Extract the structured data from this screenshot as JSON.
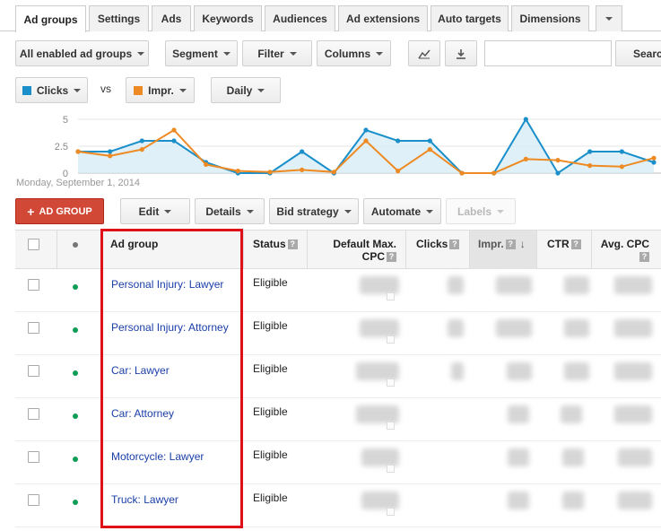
{
  "tabs": [
    "Ad groups",
    "Settings",
    "Ads",
    "Keywords",
    "Audiences",
    "Ad extensions",
    "Auto targets",
    "Dimensions"
  ],
  "toolbar": {
    "filter_select": "All enabled ad groups",
    "segment": "Segment",
    "filter": "Filter",
    "columns": "Columns",
    "search_button": "Search"
  },
  "chart_controls": {
    "metric1": "Clicks",
    "vs": "vs",
    "metric2": "Impr.",
    "granularity": "Daily"
  },
  "colors": {
    "clicks": "#1a8fc9",
    "impr": "#ee8a23",
    "add_button": "#d14836",
    "highlight": "#e0101a",
    "enabled_dot": "#0f9d58"
  },
  "chart_data": {
    "type": "line",
    "x_label_start": "Monday, September 1, 2014",
    "y_ticks": [
      "5",
      "2.5",
      "0"
    ],
    "ylim": [
      0,
      5
    ],
    "series": [
      {
        "name": "Clicks",
        "values": [
          2,
          2,
          3,
          3,
          1,
          0,
          0,
          2,
          0,
          4,
          3,
          3,
          0,
          0,
          5,
          0,
          2,
          2,
          1
        ]
      },
      {
        "name": "Impr.",
        "values": [
          2,
          1.6,
          2.2,
          4,
          0.8,
          0.2,
          0.1,
          0.3,
          0.1,
          3,
          0.2,
          2.2,
          0,
          0,
          1.3,
          1.2,
          0.7,
          0.6,
          1.4
        ]
      }
    ]
  },
  "actions": {
    "add_group": "AD GROUP",
    "edit": "Edit",
    "details": "Details",
    "bid_strategy": "Bid strategy",
    "automate": "Automate",
    "labels": "Labels"
  },
  "columns": {
    "ad_group": "Ad group",
    "status": "Status",
    "default_max_cpc_1": "Default Max.",
    "default_max_cpc_2": "CPC",
    "clicks": "Clicks",
    "impr": "Impr.",
    "ctr": "CTR",
    "avg_cpc": "Avg. CPC"
  },
  "rows": [
    {
      "name": "Personal Injury: Lawyer",
      "status": "Eligible"
    },
    {
      "name": "Personal Injury: Attorney",
      "status": "Eligible"
    },
    {
      "name": "Car: Lawyer",
      "status": "Eligible"
    },
    {
      "name": "Car: Attorney",
      "status": "Eligible"
    },
    {
      "name": "Motorcycle: Lawyer",
      "status": "Eligible"
    },
    {
      "name": "Truck: Lawyer",
      "status": "Eligible"
    }
  ]
}
